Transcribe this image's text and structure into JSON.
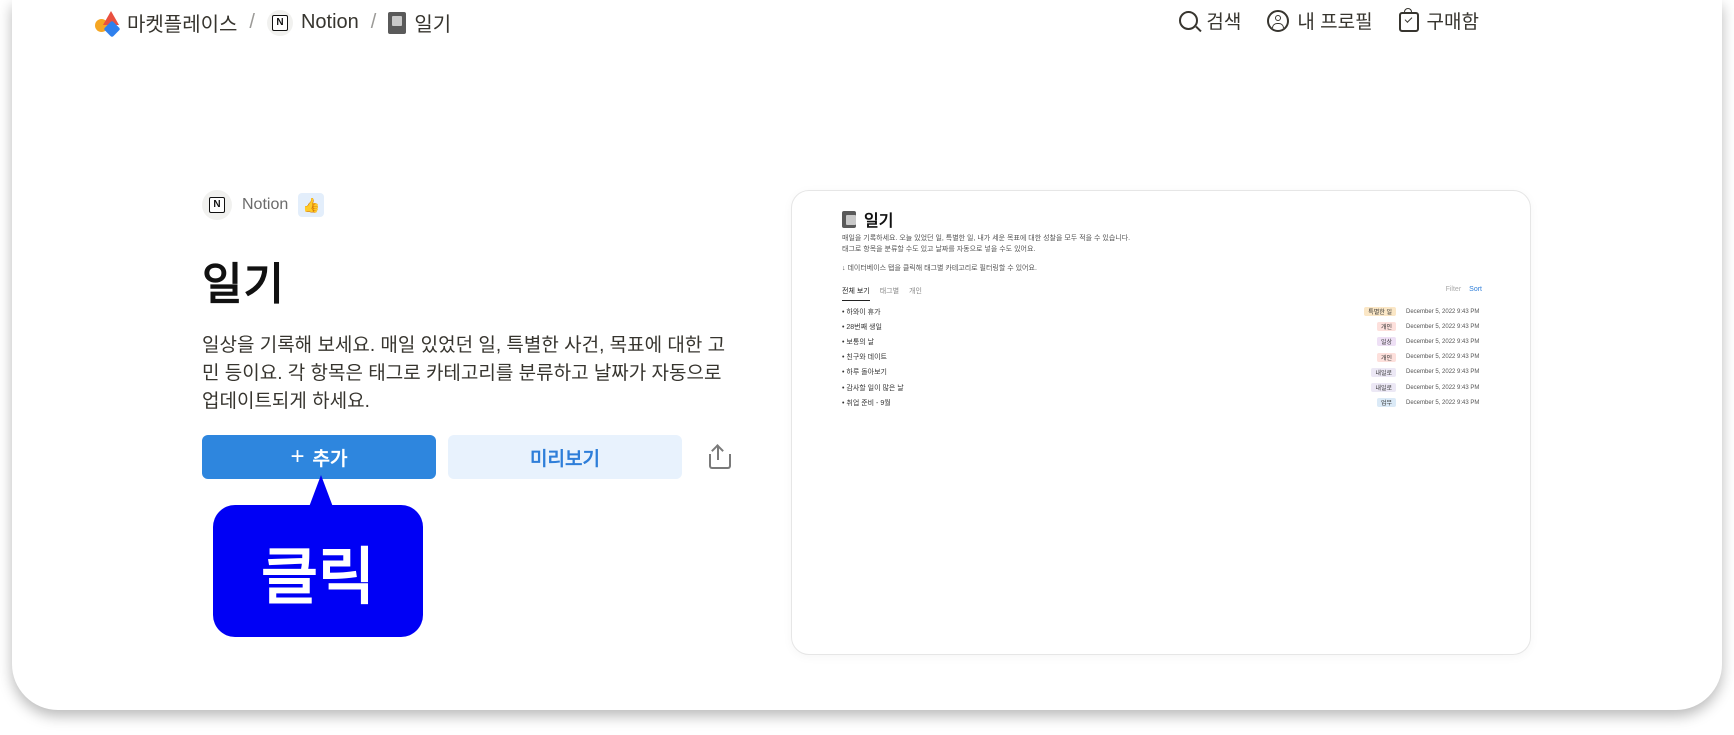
{
  "breadcrumb": {
    "marketplace": "마켓플레이스",
    "separator": "/",
    "creator": "Notion",
    "template": "일기"
  },
  "topnav": {
    "search": "검색",
    "profile": "내 프로필",
    "purchases": "구매함"
  },
  "template": {
    "creator": "Notion",
    "title": "일기",
    "description": "일상을 기록해 보세요. 매일 있었던 일, 특별한 사건, 목표에 대한 고민 등이요. 각 항목은 태그로 카테고리를 분류하고 날짜가 자동으로 업데이트되게 하세요.",
    "add_label": "추가",
    "preview_label": "미리보기"
  },
  "callout": {
    "label": "클릭"
  },
  "preview": {
    "title": "일기",
    "desc_line1": "매일을 기록하세요. 오늘 있었던 일, 특별한 일, 내가 세운 목표에 대한 성찰을 모두 적을 수 있습니다.",
    "desc_line2": "태그로 항목을 분류할 수도 있고 날짜를 자동으로 넣을 수도 있어요.",
    "hint": "↓ 데이터베이스 탭을 클릭해 태그별 카테고리로 필터링할 수 있어요.",
    "tabs": [
      "전체 보기",
      "태그별",
      "개인"
    ],
    "tools": {
      "filter": "Filter",
      "sort": "Sort"
    },
    "rows": [
      {
        "name": "하와이 휴가",
        "tag": "특별한 일",
        "date": "December 5, 2022 9:43 PM"
      },
      {
        "name": "28번째 생일",
        "tag": "개인",
        "date": "December 5, 2022 9:43 PM"
      },
      {
        "name": "보통의 날",
        "tag": "일상",
        "date": "December 5, 2022 9:43 PM"
      },
      {
        "name": "친구와 데이트",
        "tag": "개인",
        "date": "December 5, 2022 9:43 PM"
      },
      {
        "name": "하루 돌아보기",
        "tag": "내일로",
        "date": "December 5, 2022 9:43 PM"
      },
      {
        "name": "감사할 일이 많은 날",
        "tag": "내일로",
        "date": "December 5, 2022 9:43 PM"
      },
      {
        "name": "취업 준비 - 9월",
        "tag": "업무",
        "date": "December 5, 2022 9:43 PM"
      }
    ]
  },
  "colors": {
    "primary": "#2e86de",
    "preview_button_bg": "#e8f2fd",
    "callout": "#0000f5"
  }
}
